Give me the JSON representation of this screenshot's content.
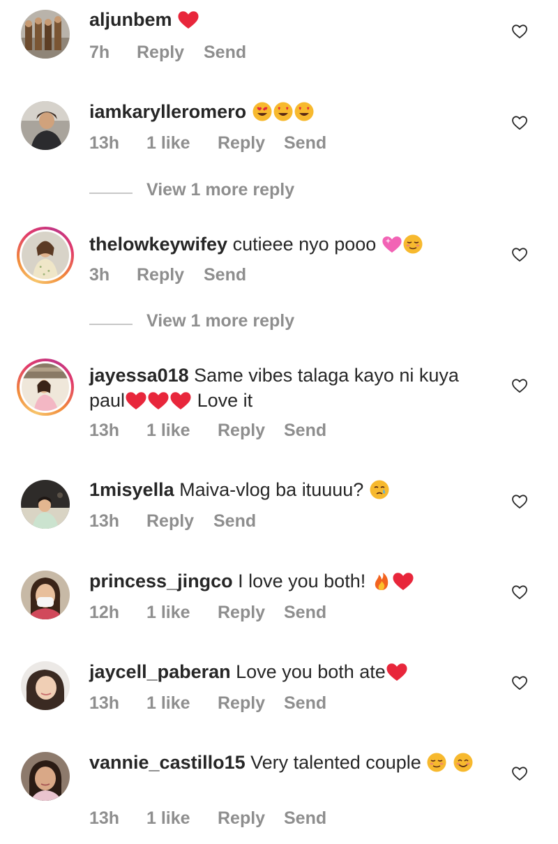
{
  "meta_labels": {
    "like": "1 like",
    "reply": "Reply",
    "send": "Send"
  },
  "view_more_label": "View 1 more reply",
  "comments": [
    {
      "username": "aljunbem",
      "text": "",
      "time": "7h",
      "likes": ""
    },
    {
      "username": "iamkarylleromero",
      "text": "",
      "time": "13h",
      "likes": "1 like"
    },
    {
      "username": "thelowkeywifey",
      "text": "cutieee nyo pooo",
      "time": "3h",
      "likes": ""
    },
    {
      "username": "jayessa018",
      "text": "Same vibes talaga kayo ni kuya paul",
      "text_after": "Love it",
      "time": "13h",
      "likes": "1 like"
    },
    {
      "username": "1misyella",
      "text": "Maiva-vlog ba ituuuu?",
      "time": "13h",
      "likes": ""
    },
    {
      "username": "princess_jingco",
      "text": "I love you both!",
      "time": "12h",
      "likes": "1 like"
    },
    {
      "username": "jaycell_paberan",
      "text": "Love you both ate",
      "time": "13h",
      "likes": "1 like"
    },
    {
      "username": "vannie_castillo15",
      "text": "Very talented couple",
      "time": "13h",
      "likes": "1 like"
    }
  ],
  "colors": {
    "text": "#262626",
    "muted": "#8e8e8e",
    "heart_red": "#e8263b",
    "divider": "#c7c7c7"
  }
}
